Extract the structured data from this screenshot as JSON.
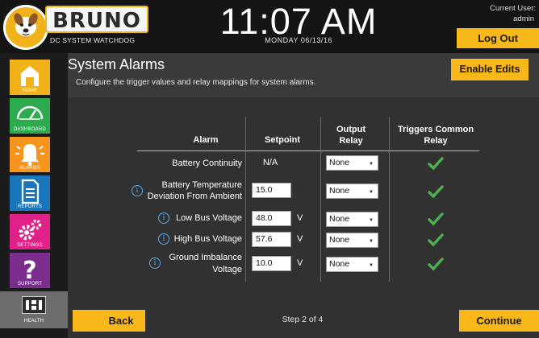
{
  "app": {
    "name": "BRUNO",
    "tagline": "DC SYSTEM WATCHDOG",
    "time": "11:07 AM",
    "date": "MONDAY 06/13/16",
    "user_label": "Current User:",
    "user_name": "admin",
    "logout_label": "Log Out",
    "accent_color": "#f9b81a"
  },
  "nav": {
    "items": [
      {
        "label": "HOME",
        "icon": "home-icon",
        "color": "#f2b21b"
      },
      {
        "label": "DASHBOARD",
        "icon": "gauge-icon",
        "color": "#2eab4f"
      },
      {
        "label": "ALARMS",
        "icon": "bell-icon",
        "color": "#f7941d"
      },
      {
        "label": "REPORTS",
        "icon": "document-icon",
        "color": "#1b75bb"
      },
      {
        "label": "SETTINGS",
        "icon": "gears-icon",
        "color": "#e0218a"
      },
      {
        "label": "SUPPORT",
        "icon": "question-icon",
        "color": "#7b2e8e"
      },
      {
        "label": "HEALTH",
        "icon": "health-icon",
        "color": "#6d6d6d"
      }
    ]
  },
  "page": {
    "title": "System Alarms",
    "subtitle": "Configure the trigger values and relay mappings for system alarms.",
    "enable_edits_label": "Enable Edits"
  },
  "table": {
    "headers": {
      "alarm": "Alarm",
      "setpoint": "Setpoint",
      "output_relay_1": "Output",
      "output_relay_2": "Relay",
      "triggers_1": "Triggers Common",
      "triggers_2": "Relay"
    },
    "rows": [
      {
        "alarm": "Battery Continuity",
        "setpoint": "N/A",
        "unit": "",
        "relay": "None",
        "triggers_common": true,
        "info": false
      },
      {
        "alarm": "Battery Temperature Deviation From Ambient",
        "alarm_1": "Battery Temperature",
        "alarm_2": "Deviation From Ambient",
        "setpoint": "15.0",
        "unit": "",
        "relay": "None",
        "triggers_common": true,
        "info": true
      },
      {
        "alarm": "Low Bus Voltage",
        "setpoint": "48.0",
        "unit": "V",
        "relay": "None",
        "triggers_common": true,
        "info": true
      },
      {
        "alarm": "High Bus Voltage",
        "setpoint": "57.6",
        "unit": "V",
        "relay": "None",
        "triggers_common": true,
        "info": true
      },
      {
        "alarm": "Ground Imbalance Voltage",
        "alarm_1": "Ground Imbalance",
        "alarm_2": "Voltage",
        "setpoint": "10.0",
        "unit": "V",
        "relay": "None",
        "triggers_common": true,
        "info": true
      }
    ]
  },
  "footer": {
    "back_label": "Back",
    "step_label": "Step 2 of 4",
    "continue_label": "Continue"
  }
}
